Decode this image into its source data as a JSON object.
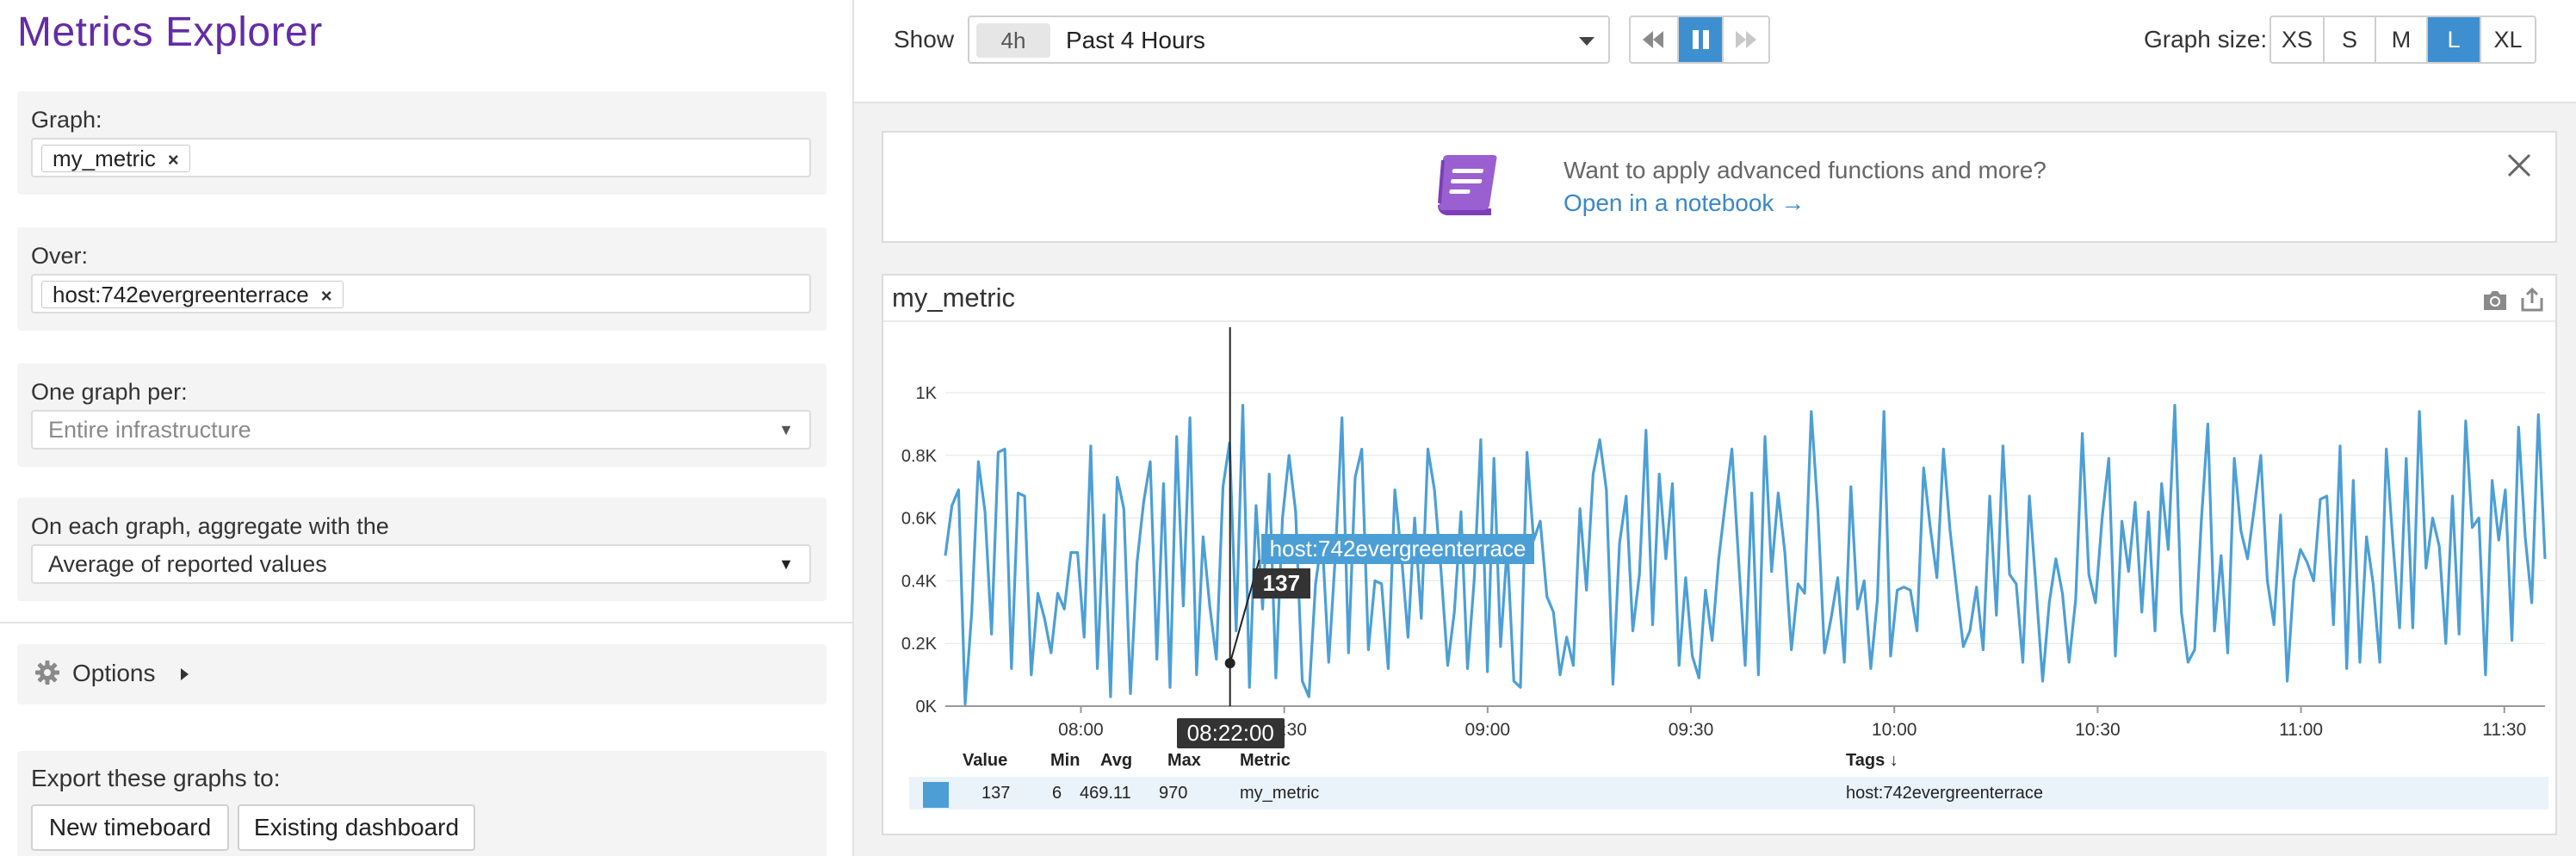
{
  "app": {
    "title": "Metrics Explorer"
  },
  "left": {
    "graph_label": "Graph:",
    "graph_tag": "my_metric",
    "over_label": "Over:",
    "over_tag": "host:742evergreenterrace",
    "tag_remove": "×",
    "one_graph_label": "One graph per:",
    "one_graph_value": "Entire infrastructure",
    "aggregate_label": "On each graph, aggregate with the",
    "aggregate_value": "Average of reported values",
    "options_label": "Options",
    "export_label": "Export these graphs to:",
    "new_timeboard": "New timeboard",
    "existing_dashboard": "Existing dashboard"
  },
  "topbar": {
    "show_label": "Show",
    "time_pill": "4h",
    "time_range": "Past 4 Hours",
    "graph_size_label": "Graph size:",
    "graph_sizes": [
      "XS",
      "S",
      "M",
      "L",
      "XL"
    ],
    "graph_size_selected": "L"
  },
  "banner": {
    "question": "Want to apply advanced functions and more?",
    "link": "Open in a notebook →"
  },
  "graph": {
    "title": "my_metric",
    "tooltip_host": "host:742evergreenterrace",
    "tooltip_value": "137",
    "tooltip_time": "08:22:00",
    "legend_headers": {
      "value": "Value",
      "min": "Min",
      "avg": "Avg",
      "max": "Max",
      "metric": "Metric",
      "tags": "Tags ↓"
    },
    "legend_row": {
      "value": "137",
      "min": "6",
      "avg": "469.11",
      "max": "970",
      "metric": "my_metric",
      "tags": "host:742evergreenterrace"
    }
  },
  "colors": {
    "accent": "#3e8fcf",
    "series": "#4c9fd5",
    "brand": "#632ca6"
  },
  "chart_data": {
    "type": "line",
    "title": "my_metric",
    "xlabel": "",
    "ylabel": "",
    "x_ticks": [
      "08:00",
      "08:30",
      "09:00",
      "09:30",
      "10:00",
      "10:30",
      "11:00",
      "11:30"
    ],
    "y_ticks": [
      "0K",
      "0.2K",
      "0.4K",
      "0.6K",
      "0.8K",
      "1K"
    ],
    "ylim": [
      0,
      1000
    ],
    "x_range_minutes_from_0800": [
      -20,
      216
    ],
    "grid": true,
    "series": [
      {
        "name": "host:742evergreenterrace",
        "x_minutes_from_0800": [],
        "values": [
          480,
          640,
          690,
          6,
          300,
          780,
          620,
          230,
          810,
          820,
          120,
          680,
          670,
          100,
          360,
          280,
          170,
          360,
          310,
          490,
          490,
          220,
          830,
          120,
          610,
          30,
          730,
          630,
          40,
          460,
          650,
          780,
          150,
          710,
          60,
          860,
          320,
          920,
          100,
          540,
          320,
          150,
          700,
          840,
          240,
          960,
          60,
          640,
          310,
          740,
          90,
          600,
          800,
          620,
          80,
          30,
          390,
          540,
          140,
          480,
          920,
          170,
          730,
          820,
          180,
          400,
          390,
          120,
          690,
          480,
          220,
          600,
          280,
          820,
          690,
          430,
          130,
          300,
          620,
          120,
          400,
          850,
          110,
          790,
          190,
          510,
          80,
          60,
          810,
          530,
          590,
          350,
          300,
          100,
          220,
          130,
          630,
          370,
          740,
          850,
          690,
          70,
          520,
          670,
          240,
          420,
          880,
          260,
          740,
          470,
          710,
          130,
          410,
          160,
          90,
          370,
          210,
          470,
          650,
          820,
          470,
          130,
          680,
          100,
          860,
          430,
          680,
          490,
          180,
          390,
          360,
          940,
          620,
          170,
          280,
          410,
          140,
          700,
          310,
          400,
          120,
          340,
          940,
          160,
          370,
          380,
          370,
          240,
          760,
          570,
          410,
          820,
          560,
          370,
          190,
          240,
          380,
          180,
          670,
          290,
          830,
          420,
          390,
          140,
          670,
          380,
          80,
          330,
          470,
          360,
          140,
          340,
          870,
          420,
          330,
          600,
          790,
          160,
          590,
          430,
          650,
          300,
          620,
          240,
          710,
          500,
          960,
          300,
          140,
          180,
          590,
          900,
          240,
          480,
          170,
          790,
          560,
          470,
          630,
          800,
          400,
          260,
          610,
          80,
          400,
          500,
          460,
          400,
          660,
          670,
          260,
          830,
          120,
          720,
          140,
          540,
          390,
          140,
          820,
          520,
          250,
          790,
          250,
          940,
          440,
          600,
          510,
          200,
          670,
          230,
          910,
          570,
          600,
          100,
          720,
          530,
          690,
          210,
          890,
          540,
          330,
          930,
          470
        ]
      }
    ],
    "highlight": {
      "time": "08:22:00",
      "value": 137
    }
  }
}
